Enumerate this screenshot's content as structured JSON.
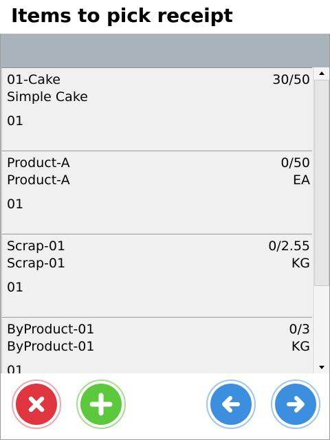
{
  "header": {
    "title": "Items to pick receipt"
  },
  "items": [
    {
      "line1_left": "01-Cake",
      "line1_right": "30/50",
      "line2_left": "Simple Cake",
      "line2_right": "",
      "line3": "01"
    },
    {
      "line1_left": "Product-A",
      "line1_right": "0/50",
      "line2_left": "Product-A",
      "line2_right": "EA",
      "line3": "01"
    },
    {
      "line1_left": "Scrap-01",
      "line1_right": "0/2.55",
      "line2_left": "Scrap-01",
      "line2_right": "KG",
      "line3": "01"
    },
    {
      "line1_left": "ByProduct-01",
      "line1_right": "0/3",
      "line2_left": "ByProduct-01",
      "line2_right": "KG",
      "line3": "01"
    }
  ],
  "footer": {
    "buttons": [
      {
        "icon": "close-icon",
        "color": "#e0353f"
      },
      {
        "icon": "plus-icon",
        "color": "#5cc83b"
      },
      {
        "icon": "arrow-left-icon",
        "color": "#3b8fde"
      },
      {
        "icon": "arrow-right-icon",
        "color": "#3b8fde"
      }
    ]
  },
  "colors": {
    "subheader": "#a9b3bb",
    "list_bg": "#f0f0f0"
  }
}
